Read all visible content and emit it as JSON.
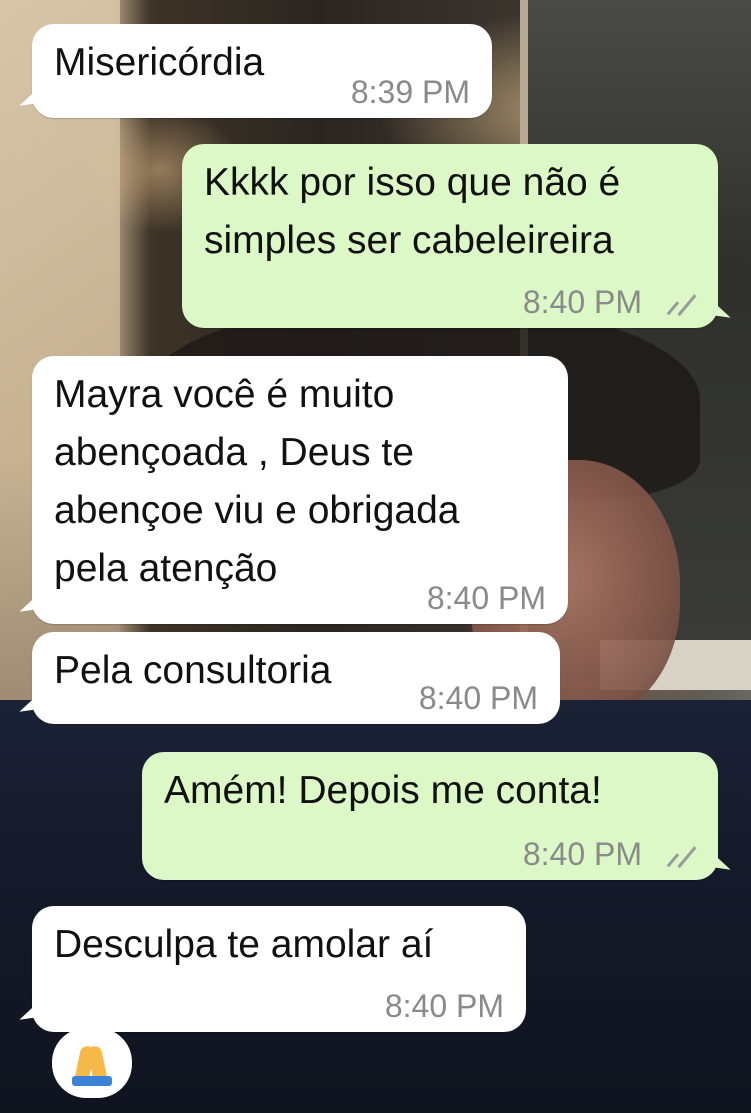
{
  "colors": {
    "incoming_bubble": "#ffffff",
    "outgoing_bubble": "#dcf8c6",
    "timestamp": "#8a8a8a"
  },
  "messages": [
    {
      "direction": "incoming",
      "text": "Misericórdia",
      "time": "8:39 PM"
    },
    {
      "direction": "outgoing",
      "text": "Kkkk por isso que não é\nsimples ser cabeleireira",
      "time": "8:40 PM",
      "status_icon": "double-check-icon"
    },
    {
      "direction": "incoming",
      "text": "Mayra você é muito\nabençoada , Deus te\nabençoe viu e obrigada\npela atenção",
      "time": "8:40 PM"
    },
    {
      "direction": "incoming",
      "text": "Pela consultoria",
      "time": "8:40 PM"
    },
    {
      "direction": "outgoing",
      "text": "Amém! Depois me conta!",
      "time": "8:40 PM",
      "status_icon": "double-check-icon"
    },
    {
      "direction": "incoming",
      "text": "Desculpa te amolar aí",
      "time": "8:40 PM"
    }
  ],
  "reaction": {
    "icon": "praying-hands-icon"
  }
}
